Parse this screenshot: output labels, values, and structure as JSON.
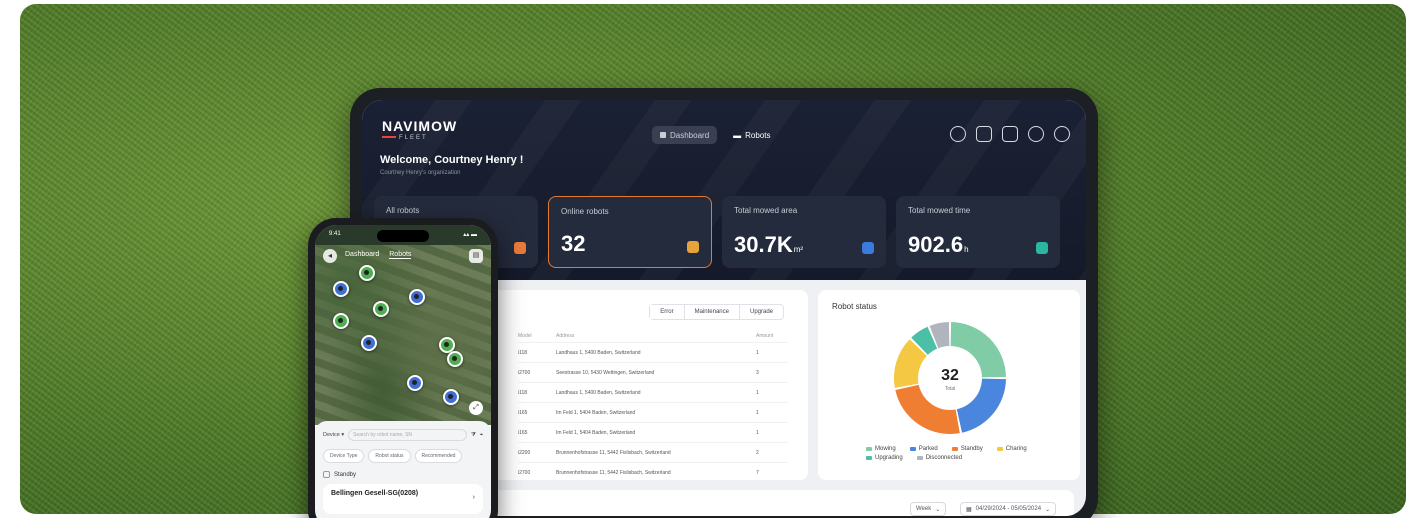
{
  "tablet": {
    "logo": "NAVIMOW",
    "logo_sub": "FLEET",
    "nav": [
      {
        "label": "Dashboard"
      },
      {
        "label": "Robots"
      }
    ],
    "welcome": "Welcome, Courtney Henry !",
    "org": "Courtney Henry's organization",
    "stats": [
      {
        "label": "All robots",
        "value": "",
        "unit": "",
        "icon_color": "#e87a3a"
      },
      {
        "label": "Online robots",
        "value": "32",
        "unit": "",
        "icon_color": "#e8a23a"
      },
      {
        "label": "Total mowed area",
        "value": "30.7K",
        "unit": "m²",
        "icon_color": "#3b7be0"
      },
      {
        "label": "Total mowed time",
        "value": "902.6",
        "unit": "h",
        "icon_color": "#2cb5a0"
      }
    ],
    "segments": [
      "Error",
      "Maintenance",
      "Upgrade"
    ],
    "table": {
      "headers": [
        "Model",
        "Address",
        "Amount"
      ],
      "rows": [
        [
          "i118",
          "Landhaus 1, 5400 Baden, Switzerland",
          "1"
        ],
        [
          "i2700",
          "Seestrasse 10, 5430 Wettingen, Switzerland",
          "3"
        ],
        [
          "i118",
          "Landhaus 1, 5400 Baden, Switzerland",
          "1"
        ],
        [
          "i165",
          "Im Feld 1, 5404 Baden, Switzerland",
          "1"
        ],
        [
          "i165",
          "Im Feld 1, 5404 Baden, Switzerland",
          "1"
        ],
        [
          "i2200",
          "Brunnenhofstrasse 11, 5442 Fislisbach, Switzerland",
          "2"
        ],
        [
          "i2700",
          "Brunnenhofstrasse 11, 5442 Fislisbach, Switzerland",
          "7"
        ]
      ]
    },
    "robot_status": {
      "title": "Robot status",
      "total": "32",
      "total_label": "Total",
      "segments": [
        {
          "name": "Mowing",
          "value": 8,
          "color": "#7fcca7"
        },
        {
          "name": "Parked",
          "value": 7,
          "color": "#4a86de"
        },
        {
          "name": "Standby",
          "value": 8,
          "color": "#ef7d32"
        },
        {
          "name": "Charing",
          "value": 5,
          "color": "#f4c842"
        },
        {
          "name": "Upgrading",
          "value": 2,
          "color": "#4dbfa6"
        },
        {
          "name": "Disconnected",
          "value": 2,
          "color": "#b0b4bc"
        }
      ]
    },
    "bottom": {
      "select": "Week",
      "date_range": "04/29/2024 - 05/05/2024"
    }
  },
  "phone": {
    "time": "9:41",
    "tabs": [
      "Dashboard",
      "Robots"
    ],
    "search_label": "Device ▾",
    "search_placeholder": "Search by robot name, SN",
    "chips": [
      "Device Type",
      "Robot status",
      "Recommended"
    ],
    "standby": "Standby",
    "robot_name": "Bellingen Gesell-SG(0208)"
  }
}
